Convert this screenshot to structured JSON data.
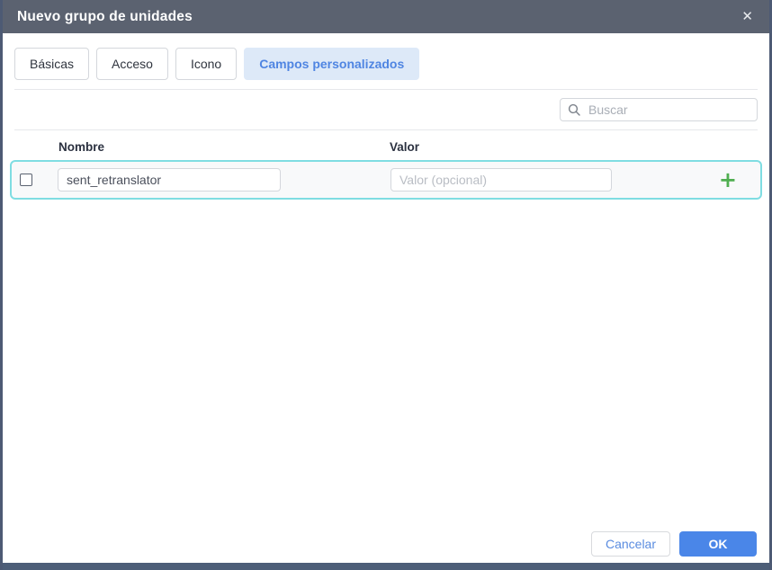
{
  "dialog": {
    "title": "Nuevo grupo de unidades",
    "close_icon": "✕"
  },
  "tabs": [
    {
      "label": "Básicas",
      "active": false
    },
    {
      "label": "Acceso",
      "active": false
    },
    {
      "label": "Icono",
      "active": false
    },
    {
      "label": "Campos personalizados",
      "active": true
    }
  ],
  "search": {
    "placeholder": "Buscar"
  },
  "table": {
    "headers": {
      "name": "Nombre",
      "value": "Valor"
    },
    "rows": [
      {
        "checked": false,
        "name": "sent_retranslator",
        "value": "",
        "value_placeholder": "Valor (opcional)",
        "add_icon": "+"
      }
    ]
  },
  "footer": {
    "cancel": "Cancelar",
    "ok": "OK"
  },
  "colors": {
    "titlebar_bg": "#5b6270",
    "frame_border": "#4d5a74",
    "bottom_bar": "#4d5e78",
    "active_tab_bg": "#dde9f8",
    "active_tab_text": "#4f85e2",
    "row_highlight_border": "#7fdde2",
    "plus_green": "#4fae50",
    "ok_button_bg": "#4a86e8",
    "cancel_text": "#5a8ce0"
  }
}
